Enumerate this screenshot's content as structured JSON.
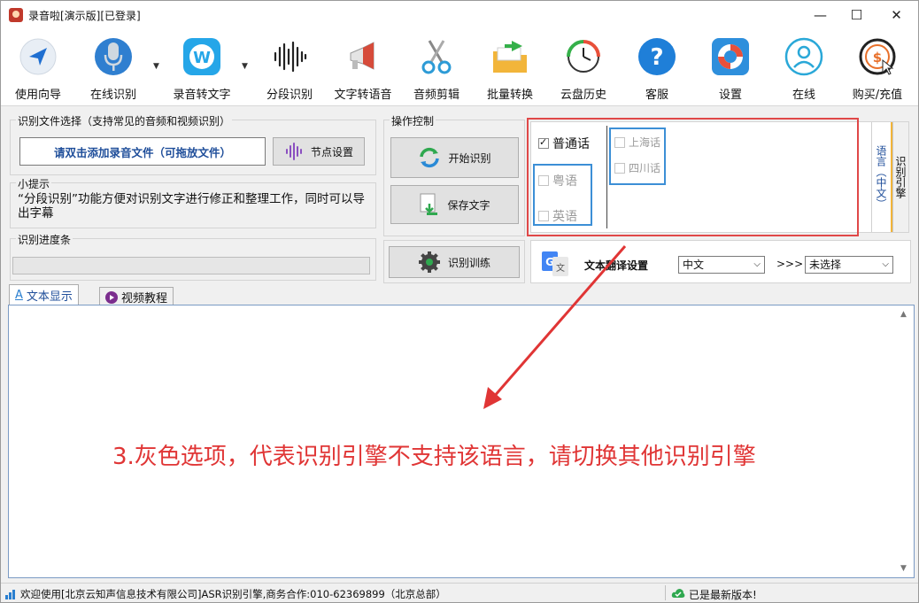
{
  "window": {
    "title": "录音啦[演示版][已登录]",
    "controls": {
      "minimize": "—",
      "maximize": "☐",
      "close": "✕"
    }
  },
  "toolbar": {
    "items": [
      {
        "label": "使用向导",
        "icon": "navigation-arrow-icon"
      },
      {
        "label": "在线识别",
        "icon": "microphone-icon"
      },
      {
        "label": "录音转文字",
        "icon": "w-app-icon"
      },
      {
        "label": "分段识别",
        "icon": "waveform-icon"
      },
      {
        "label": "文字转语音",
        "icon": "megaphone-icon"
      },
      {
        "label": "音频剪辑",
        "icon": "scissors-icon"
      },
      {
        "label": "批量转换",
        "icon": "folder-arrow-icon"
      },
      {
        "label": "云盘历史",
        "icon": "history-clock-icon"
      },
      {
        "label": "客服",
        "icon": "help-question-icon"
      },
      {
        "label": "设置",
        "icon": "lifebuoy-icon"
      },
      {
        "label": "在线",
        "icon": "user-icon"
      },
      {
        "label": "购买/充值",
        "icon": "dollar-cursor-icon"
      }
    ]
  },
  "file_select": {
    "title": "识别文件选择（支持常见的音频和视频识别）",
    "add_file_label": "请双击添加录音文件（可拖放文件）",
    "node_settings_label": "节点设置"
  },
  "tips": {
    "title": "小提示",
    "text": "“分段识别”功能方便对识别文字进行修正和整理工作，同时可以导出字幕"
  },
  "operation": {
    "title": "操作控制",
    "start_label": "开始识别",
    "save_label": "保存文字",
    "train_label": "识别训练"
  },
  "progress": {
    "title": "识别进度条",
    "value": 0
  },
  "language": {
    "options": [
      {
        "label": "普通话",
        "checked": true,
        "enabled": true
      },
      {
        "label": "粤语",
        "checked": false,
        "enabled": false
      },
      {
        "label": "英语",
        "checked": false,
        "enabled": false
      },
      {
        "label": "上海话",
        "checked": false,
        "enabled": false
      },
      {
        "label": "四川话",
        "checked": false,
        "enabled": false
      }
    ],
    "side_tab_label": "语言（中文）",
    "engine_tab_label": "识别引擎"
  },
  "translate": {
    "label": "文本翻译设置",
    "from": "中文",
    "arrow": ">>>",
    "to": "未选择"
  },
  "tabs": [
    {
      "label": "文本显示",
      "active": true
    },
    {
      "label": "视频教程",
      "active": false
    }
  ],
  "annotation": "3.灰色选项，代表识别引擎不支持该语言，请切换其他识别引擎",
  "status": {
    "left": "欢迎使用[北京云知声信息技术有限公司]ASR识别引擎,商务合作:010-62369899（北京总部）",
    "right": "已是最新版本!"
  },
  "colors": {
    "annotation": "#e03535",
    "highlight_red": "#e04848",
    "highlight_blue": "#3c8fd6",
    "link_text": "#1f4e9a"
  }
}
